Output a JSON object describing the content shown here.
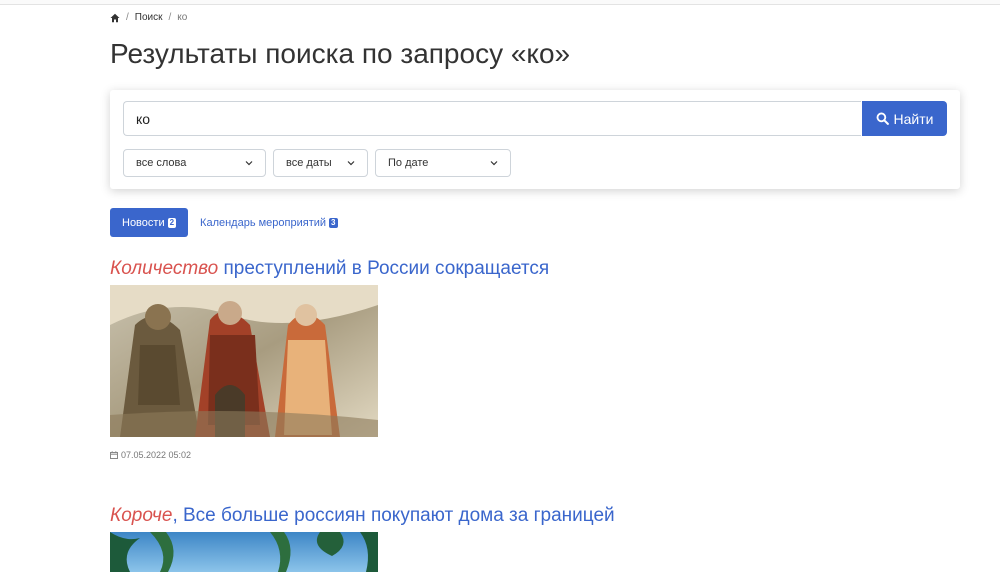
{
  "breadcrumb": {
    "home_icon": "home-icon",
    "items": [
      "Поиск",
      "ко"
    ]
  },
  "page_title": "Результаты поиска по запросу «ко»",
  "search": {
    "value": "ко",
    "button_label": "Найти",
    "button_icon": "search-icon"
  },
  "filters": {
    "words": "все слова",
    "dates": "все даты",
    "sort": "По дате"
  },
  "tabs": [
    {
      "label": "Новости",
      "count": "2",
      "active": true
    },
    {
      "label": "Календарь мероприятий",
      "count": "3",
      "active": false
    }
  ],
  "results": [
    {
      "title_highlight": "Количество",
      "title_rest": " преступлений в России сокращается",
      "date": "07.05.2022 05:02",
      "date_icon": "calendar-icon"
    },
    {
      "title_highlight": "Короче",
      "title_rest": ", Все больше россиян покупают дома за границей"
    }
  ],
  "colors": {
    "accent": "#3a66cc",
    "highlight": "#d9534f"
  }
}
